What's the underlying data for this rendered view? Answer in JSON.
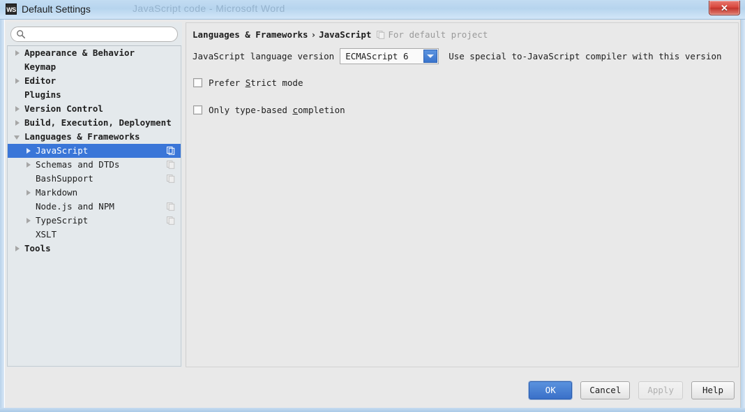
{
  "window": {
    "title": "Default Settings",
    "app_icon_label": "WS",
    "ghost_title": "JavaScript code - Microsoft Word",
    "close_icon": "close-icon"
  },
  "search": {
    "value": "",
    "placeholder": "",
    "icon": "search-icon"
  },
  "tree": {
    "items": [
      {
        "label": "Appearance & Behavior",
        "level": 0,
        "arrow": "right",
        "bold": true,
        "copy": false,
        "selected": false
      },
      {
        "label": "Keymap",
        "level": 0,
        "arrow": "none",
        "bold": true,
        "copy": false,
        "selected": false
      },
      {
        "label": "Editor",
        "level": 0,
        "arrow": "right",
        "bold": true,
        "copy": false,
        "selected": false
      },
      {
        "label": "Plugins",
        "level": 0,
        "arrow": "none",
        "bold": true,
        "copy": false,
        "selected": false
      },
      {
        "label": "Version Control",
        "level": 0,
        "arrow": "right",
        "bold": true,
        "copy": false,
        "selected": false
      },
      {
        "label": "Build, Execution, Deployment",
        "level": 0,
        "arrow": "right",
        "bold": true,
        "copy": false,
        "selected": false
      },
      {
        "label": "Languages & Frameworks",
        "level": 0,
        "arrow": "down",
        "bold": true,
        "copy": false,
        "selected": false
      },
      {
        "label": "JavaScript",
        "level": 1,
        "arrow": "right",
        "bold": false,
        "copy": true,
        "selected": true
      },
      {
        "label": "Schemas and DTDs",
        "level": 1,
        "arrow": "right",
        "bold": false,
        "copy": true,
        "selected": false
      },
      {
        "label": "BashSupport",
        "level": 1,
        "arrow": "none",
        "bold": false,
        "copy": true,
        "selected": false
      },
      {
        "label": "Markdown",
        "level": 1,
        "arrow": "right",
        "bold": false,
        "copy": false,
        "selected": false
      },
      {
        "label": "Node.js and NPM",
        "level": 1,
        "arrow": "none",
        "bold": false,
        "copy": true,
        "selected": false
      },
      {
        "label": "TypeScript",
        "level": 1,
        "arrow": "right",
        "bold": false,
        "copy": true,
        "selected": false
      },
      {
        "label": "XSLT",
        "level": 1,
        "arrow": "none",
        "bold": false,
        "copy": false,
        "selected": false
      },
      {
        "label": "Tools",
        "level": 0,
        "arrow": "right",
        "bold": true,
        "copy": false,
        "selected": false
      }
    ]
  },
  "content": {
    "breadcrumb_main": "Languages & Frameworks",
    "breadcrumb_separator": "›",
    "breadcrumb_page": "JavaScript",
    "breadcrumb_scope": "For default project",
    "breadcrumb_icon": "copy-scope-icon",
    "version_label": "JavaScript language version",
    "version_value": "ECMAScript 6",
    "version_hint": "Use special to-JavaScript compiler with this version",
    "checkbox_strict_pre": "Prefer ",
    "checkbox_strict_mnemonic": "S",
    "checkbox_strict_post": "trict mode",
    "checkbox_strict_checked": false,
    "checkbox_completion_pre": "Only type-based ",
    "checkbox_completion_mnemonic": "c",
    "checkbox_completion_post": "ompletion",
    "checkbox_completion_checked": false
  },
  "buttons": {
    "ok": "OK",
    "cancel": "Cancel",
    "apply": "Apply",
    "help": "Help"
  },
  "colors": {
    "selection_blue": "#3a76d8",
    "primary_button_blue": "#3a70c8",
    "close_red": "#d8463c",
    "tree_background": "#e4e9ec",
    "panel_background": "#e9e9e9",
    "muted_text": "#9a9a9a"
  }
}
